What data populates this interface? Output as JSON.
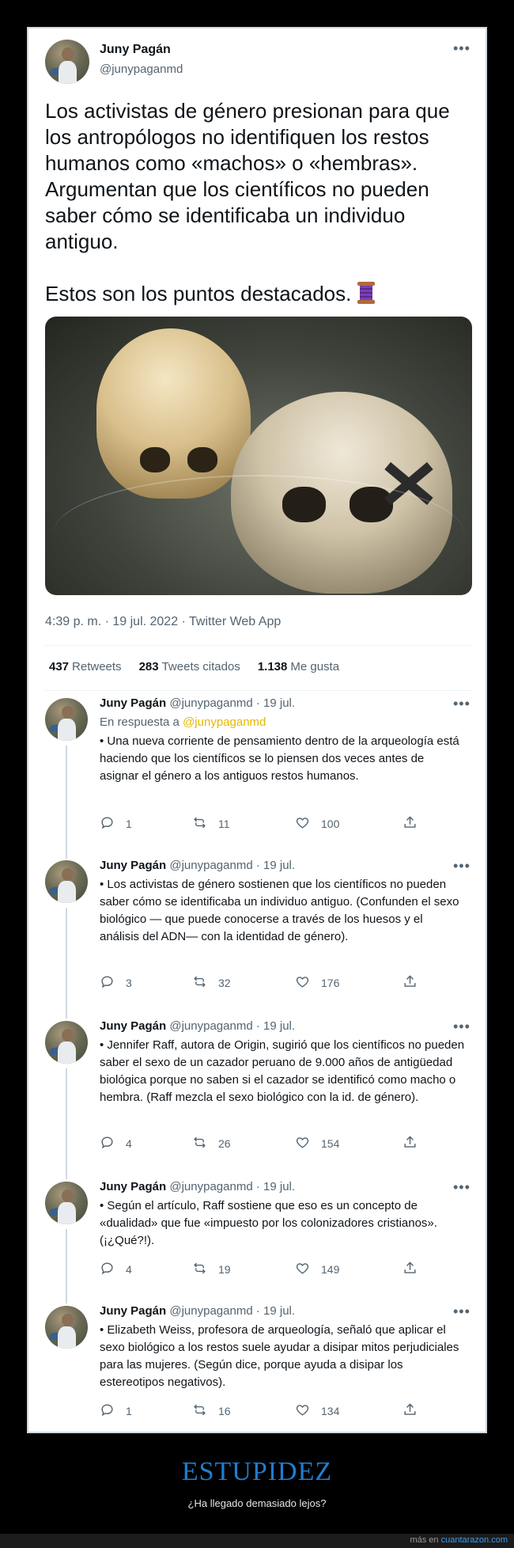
{
  "tweet": {
    "name": "Juny Pagán",
    "handle": "@junypaganmd",
    "text": "Los activistas de género presionan para que los antropólogos no identifiquen los restos humanos como «machos» o «hembras». Argumentan que los científicos no pueden saber cómo se identificaba un individuo antiguo.",
    "text2": "Estos son los puntos destacados.",
    "meta": "4:39 p. m. · 19 jul. 2022 · Twitter Web App",
    "stats": {
      "retweets_num": "437",
      "retweets_label": "Retweets",
      "quotes_num": "283",
      "quotes_label": "Tweets citados",
      "likes_num": "1.138",
      "likes_label": "Me gusta"
    }
  },
  "replies": [
    {
      "name": "Juny Pagán",
      "handle": "@junypaganmd",
      "time": "· 19 jul.",
      "reply_to_prefix": "En respuesta a",
      "reply_to_mention": "@junypaganmd",
      "text": "• Una nueva corriente de pensamiento dentro de la arqueología está haciendo que los científicos se lo piensen dos veces antes de asignar el género a los antiguos restos humanos.",
      "replies": "1",
      "retweets": "11",
      "likes": "100"
    },
    {
      "name": "Juny Pagán",
      "handle": "@junypaganmd",
      "time": "· 19 jul.",
      "text": "• Los activistas de género sostienen que los científicos no pueden saber cómo se identificaba un individuo antiguo. (Confunden el sexo biológico — que puede conocerse a través de los huesos y el análisis del ADN— con la identidad de género).",
      "replies": "3",
      "retweets": "32",
      "likes": "176"
    },
    {
      "name": "Juny Pagán",
      "handle": "@junypaganmd",
      "time": "· 19 jul.",
      "text": "• Jennifer Raff, autora de Origin, sugirió que los científicos no pueden saber el sexo de un cazador peruano de 9.000 años de antigüedad biológica porque no saben si el cazador se identificó como macho o hembra. (Raff mezcla el sexo biológico con la id. de género).",
      "replies": "4",
      "retweets": "26",
      "likes": "154"
    },
    {
      "name": "Juny Pagán",
      "handle": "@junypaganmd",
      "time": "· 19 jul.",
      "text": "• Según el artículo, Raff sostiene que eso es un concepto de «dualidad» que fue «impuesto por los colonizadores cristianos». (¡¿Qué?!).",
      "replies": "4",
      "retweets": "19",
      "likes": "149"
    },
    {
      "name": "Juny Pagán",
      "handle": "@junypaganmd",
      "time": "· 19 jul.",
      "text": "• Elizabeth Weiss, profesora de arqueología, señaló que aplicar el sexo biológico a los restos suele ayudar a disipar mitos perjudiciales para las mujeres. (Según dice, porque ayuda a disipar los estereotipos negativos).",
      "replies": "1",
      "retweets": "16",
      "likes": "134"
    }
  ],
  "footer": {
    "title": "ESTUPIDEZ",
    "subtitle": "¿Ha llegado demasiado lejos?",
    "credit_prefix": "más en",
    "credit_site": "cuantarazon.com"
  },
  "colors": {
    "mention": "#e6b800",
    "footer_title": "#1f7ecf",
    "link": "#3d9be9"
  }
}
